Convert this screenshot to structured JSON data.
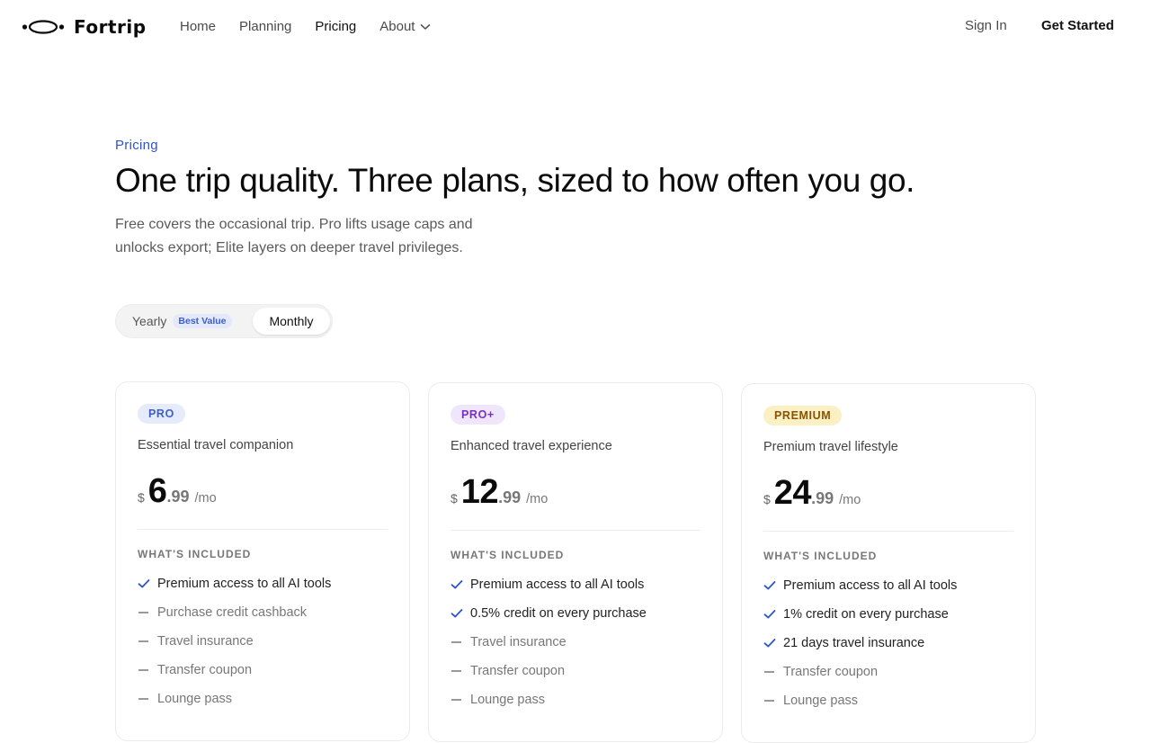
{
  "brand": {
    "name": "Fortrip"
  },
  "nav": {
    "items": [
      {
        "label": "Home",
        "active": false
      },
      {
        "label": "Planning",
        "active": false
      },
      {
        "label": "Pricing",
        "active": true
      },
      {
        "label": "About",
        "active": false,
        "has_dropdown": true
      }
    ],
    "signin_label": "Sign In",
    "cta_label": "Get Started"
  },
  "hero": {
    "eyebrow": "Pricing",
    "title": "One trip quality. Three plans, sized to how often you go.",
    "subtitle": "Free covers the occasional trip. Pro lifts usage caps and unlocks export; Elite layers on deeper travel privileges."
  },
  "billing_toggle": {
    "yearly_label": "Yearly",
    "yearly_badge": "Best Value",
    "monthly_label": "Monthly",
    "selected": "Monthly"
  },
  "colors": {
    "accent_blue": "#2f55c6",
    "check_blue": "#2f55c6",
    "pro_badge_bg": "#e6ebfb",
    "pro_badge_fg": "#3e5fc9",
    "proplus_badge_bg": "#f0e6fb",
    "proplus_badge_fg": "#7a2fc4",
    "premium_badge_bg": "#fbf0c4",
    "premium_badge_fg": "#8a5200"
  },
  "plans": [
    {
      "badge": "PRO",
      "description": "Essential travel companion",
      "currency": "$",
      "price_int": "6",
      "price_dec": ".99",
      "period": "/mo",
      "included_title": "WHAT'S INCLUDED",
      "features": [
        {
          "label": "Premium access to all AI tools",
          "included": true
        },
        {
          "label": "Purchase credit cashback",
          "included": false
        },
        {
          "label": "Travel insurance",
          "included": false
        },
        {
          "label": "Transfer coupon",
          "included": false
        },
        {
          "label": "Lounge pass",
          "included": false
        }
      ]
    },
    {
      "badge": "PRO+",
      "description": "Enhanced travel experience",
      "currency": "$",
      "price_int": "12",
      "price_dec": ".99",
      "period": "/mo",
      "included_title": "WHAT'S INCLUDED",
      "features": [
        {
          "label": "Premium access to all AI tools",
          "included": true
        },
        {
          "label": "0.5% credit on every purchase",
          "included": true
        },
        {
          "label": "Travel insurance",
          "included": false
        },
        {
          "label": "Transfer coupon",
          "included": false
        },
        {
          "label": "Lounge pass",
          "included": false
        }
      ]
    },
    {
      "badge": "PREMIUM",
      "description": "Premium travel lifestyle",
      "currency": "$",
      "price_int": "24",
      "price_dec": ".99",
      "period": "/mo",
      "included_title": "WHAT'S INCLUDED",
      "features": [
        {
          "label": "Premium access to all AI tools",
          "included": true
        },
        {
          "label": "1% credit on every purchase",
          "included": true
        },
        {
          "label": "21 days travel insurance",
          "included": true
        },
        {
          "label": "Transfer coupon",
          "included": false
        },
        {
          "label": "Lounge pass",
          "included": false
        }
      ]
    }
  ]
}
